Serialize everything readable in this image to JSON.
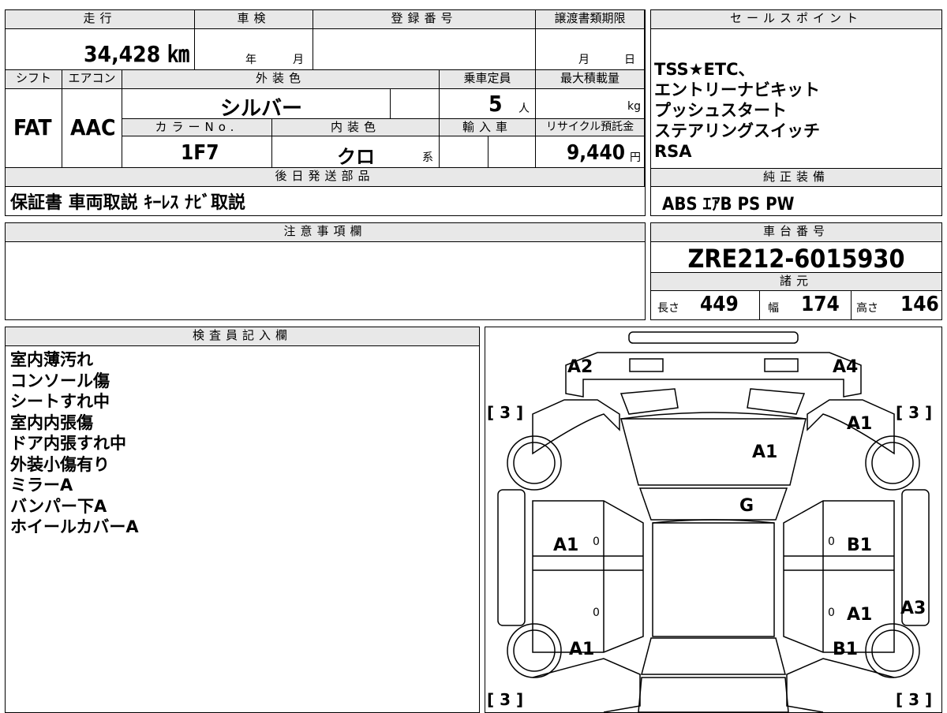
{
  "basic": {
    "mileage_label": "走行",
    "mileage_value": "34,428 ㎞",
    "shaken_label": "車検",
    "shaken_year": "年",
    "shaken_month": "月",
    "reg_number_label": "登録番号",
    "doc_deadline_label": "譲渡書類期限",
    "doc_month": "月",
    "doc_day": "日"
  },
  "spec": {
    "shift_label": "シフト",
    "shift_value": "FAT",
    "ac_label": "エアコン",
    "ac_value": "AAC",
    "exterior_color_label": "外装色",
    "exterior_color_value": "シルバー",
    "capacity_label": "乗車定員",
    "capacity_value": "5",
    "capacity_unit": "人",
    "max_load_label": "最大積載量",
    "max_load_unit": "kg",
    "color_no_label": "カラーNo.",
    "color_no_value": "1F7",
    "interior_color_label": "内装色",
    "interior_color_value": "クロ",
    "interior_color_suffix": "系",
    "import_label": "輸入車",
    "recycle_label": "リサイクル預託金",
    "recycle_value": "9,440",
    "recycle_unit": "円"
  },
  "later_parts": {
    "label": "後日発送部品",
    "value": "保証書 車両取説 ｷｰﾚｽ ﾅﾋﾞ取説"
  },
  "sales_points": {
    "label": "セールスポイント",
    "lines": [
      "TSS★ETC、",
      "エントリーナビキット",
      "プッシュスタート",
      "ステアリングスイッチ",
      "RSA"
    ]
  },
  "genuine": {
    "label": "純正装備",
    "value": "ABS ｴｱB PS PW"
  },
  "notes": {
    "label": "注意事項欄"
  },
  "chassis": {
    "label": "車台番号",
    "value": "ZRE212-6015930",
    "dims_label": "諸元",
    "length_label": "長さ",
    "length_value": "449",
    "width_label": "幅",
    "width_value": "174",
    "height_label": "高さ",
    "height_value": "146"
  },
  "inspector": {
    "label": "検査員記入欄",
    "lines": [
      "室内薄汚れ",
      "コンソール傷",
      "シートすれ中",
      "室内内張傷",
      "ドア内張すれ中",
      "外装小傷有り",
      "ミラーA",
      "バンパー下A",
      "ホイールカバーA"
    ]
  },
  "diagram": {
    "a2": "A2",
    "a4": "A4",
    "tread_fl": "[ 3 ]",
    "tread_fr": "[ 3 ]",
    "tread_rl": "[ 3 ]",
    "tread_rr": "[ 3 ]",
    "fender_r": "A1",
    "hood": "A1",
    "windshield": "G",
    "door_fl": "A1",
    "door_fr": "B1",
    "door_rr": "A1",
    "side_r": "A3",
    "fender_rl": "A1",
    "fender_rr": "B1",
    "zero1": "0",
    "zero2": "0",
    "zero3": "0",
    "zero4": "0"
  }
}
